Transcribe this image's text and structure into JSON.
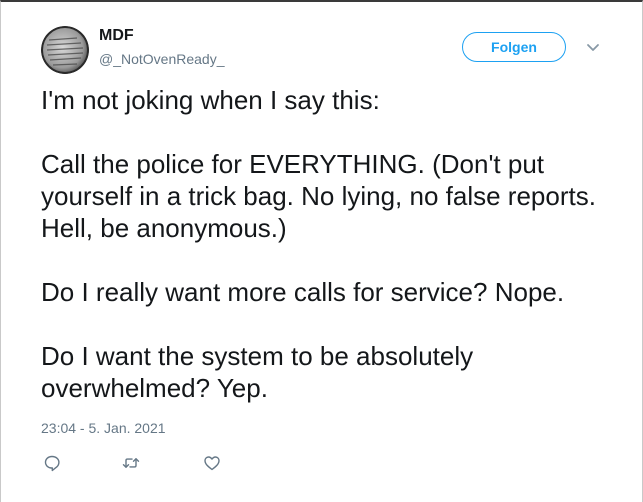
{
  "author": {
    "name": "MDF",
    "handle": "@_NotOvenReady_"
  },
  "follow_button": {
    "label": "Folgen"
  },
  "tweet": {
    "paragraphs": [
      "I'm not joking when I say this:",
      "Call the police for EVERYTHING. (Don't put yourself in a trick bag. No lying, no false reports. Hell, be anonymous.)",
      "Do I really want more calls for service? Nope.",
      "Do I want the system to be absolutely overwhelmed? Yep."
    ],
    "timestamp": "23:04 - 5. Jan. 2021"
  },
  "icons": {
    "menu": "chevron-down-icon",
    "reply": "reply-icon",
    "retweet": "retweet-icon",
    "like": "heart-icon"
  },
  "colors": {
    "accent": "#1da1f2",
    "text": "#14171a",
    "secondary": "#657786"
  }
}
